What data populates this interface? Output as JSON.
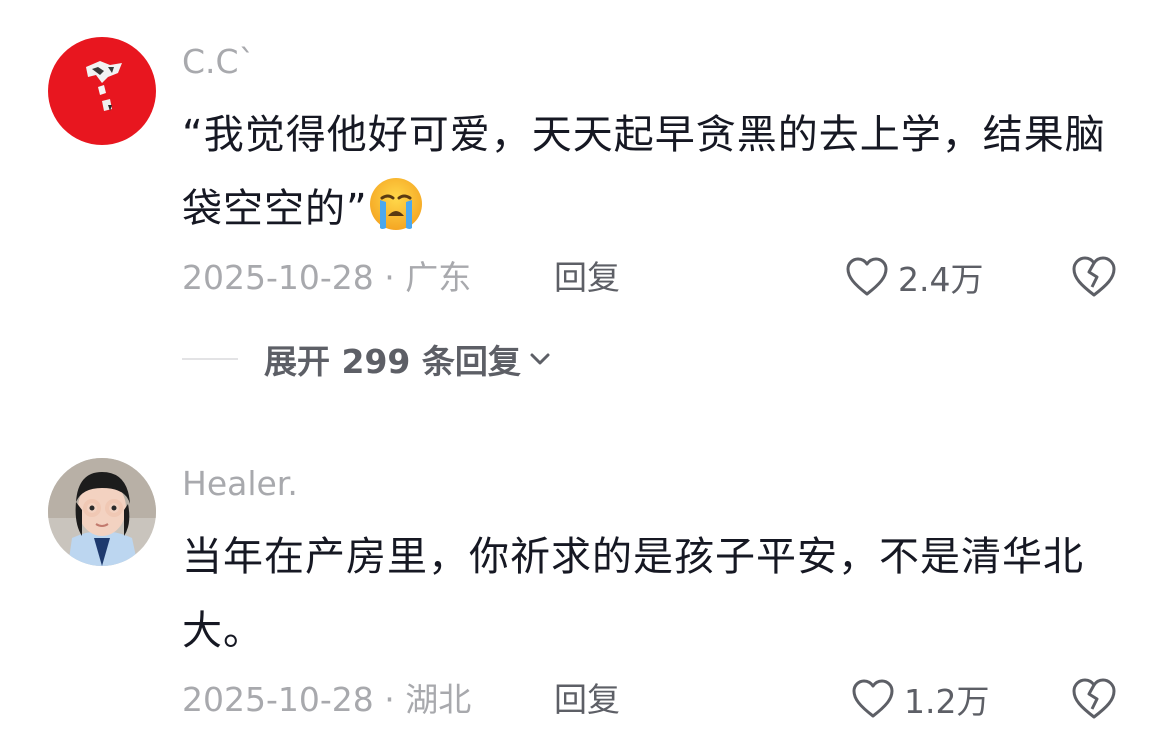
{
  "comments": [
    {
      "username": "C.C`",
      "text": "“我觉得他好可爱，天天起早贪黑的去上学，结果脑袋空空的”",
      "emoji": "loudly-crying-face",
      "date_location": "2025-10-28 · 广东",
      "reply_label": "回复",
      "like_count": "2.4万",
      "expand_label": "展开 299 条回复",
      "avatar_color": "#e8161f"
    },
    {
      "username": "Healer.",
      "text": "当年在产房里，你祈求的是孩子平安，不是清华北大。",
      "date_location": "2025-10-28 · 湖北",
      "reply_label": "回复",
      "like_count": "1.2万"
    }
  ],
  "colors": {
    "primary_text": "#161823",
    "secondary_text": "#a8a9ad",
    "action_text": "#5d5f66"
  }
}
